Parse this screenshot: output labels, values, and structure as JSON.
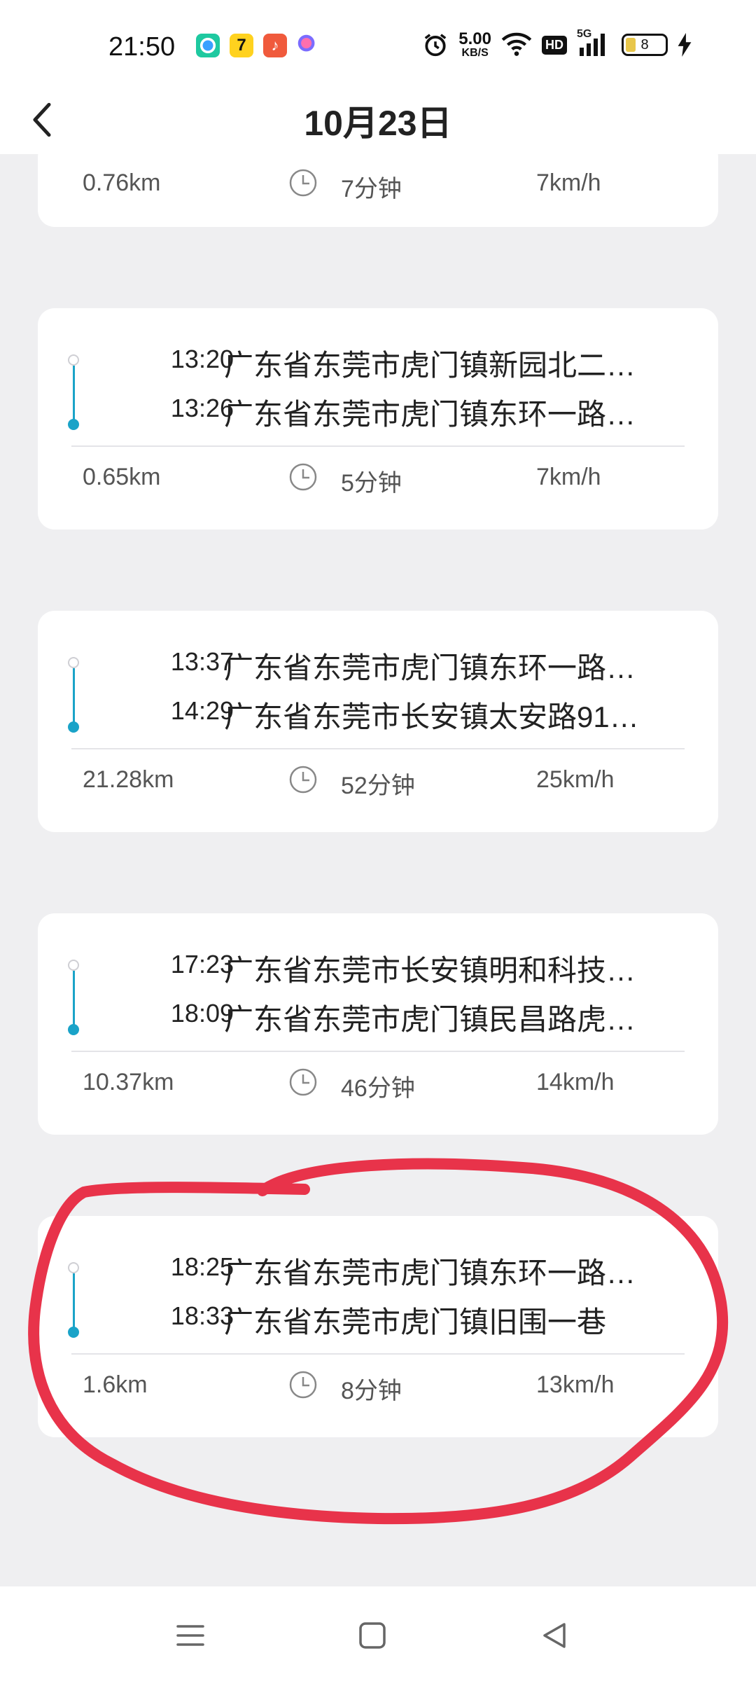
{
  "status_bar": {
    "time": "21:50",
    "net_speed_value": "5.00",
    "net_speed_unit": "KB/S",
    "hd_label": "HD",
    "network_label": "5G",
    "battery_level": "8"
  },
  "header": {
    "title": "10月23日"
  },
  "partial_trip": {
    "distance": "0.76km",
    "duration": "7分钟",
    "speed": "7km/h"
  },
  "trips": [
    {
      "start_time": "13:20",
      "start_address": "广东省东莞市虎门镇新园北二…",
      "end_time": "13:26",
      "end_address": "广东省东莞市虎门镇东环一路…",
      "distance": "0.65km",
      "duration": "5分钟",
      "speed": "7km/h"
    },
    {
      "start_time": "13:37",
      "start_address": "广东省东莞市虎门镇东环一路…",
      "end_time": "14:29",
      "end_address": "广东省东莞市长安镇太安路91…",
      "distance": "21.28km",
      "duration": "52分钟",
      "speed": "25km/h"
    },
    {
      "start_time": "17:23",
      "start_address": "广东省东莞市长安镇明和科技…",
      "end_time": "18:09",
      "end_address": "广东省东莞市虎门镇民昌路虎…",
      "distance": "10.37km",
      "duration": "46分钟",
      "speed": "14km/h"
    },
    {
      "start_time": "18:25",
      "start_address": "广东省东莞市虎门镇东环一路…",
      "end_time": "18:33",
      "end_address": "广东省东莞市虎门镇旧围一巷",
      "distance": "1.6km",
      "duration": "8分钟",
      "speed": "13km/h"
    }
  ],
  "colors": {
    "accent": "#1aa3c8",
    "annotation": "#e8334a",
    "background": "#efeff1"
  },
  "icons": {
    "back": "chevron-left-icon",
    "clock": "clock-icon",
    "nav_menu": "menu-icon",
    "nav_home": "home-square-icon",
    "nav_back": "back-triangle-icon"
  }
}
